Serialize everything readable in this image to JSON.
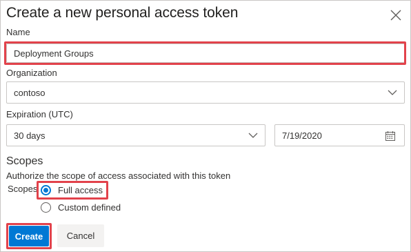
{
  "dialog": {
    "title": "Create a new personal access token"
  },
  "name": {
    "label": "Name",
    "value": "Deployment Groups"
  },
  "organization": {
    "label": "Organization",
    "value": "contoso"
  },
  "expiration": {
    "label": "Expiration (UTC)",
    "duration": "30 days",
    "date": "7/19/2020"
  },
  "scopes": {
    "title": "Scopes",
    "description": "Authorize the scope of access associated with this token",
    "label": "Scopes",
    "options": [
      {
        "label": "Full access",
        "selected": true
      },
      {
        "label": "Custom defined",
        "selected": false
      }
    ]
  },
  "actions": {
    "create": "Create",
    "cancel": "Cancel"
  },
  "colors": {
    "accent": "#0078d4",
    "highlight": "#e2424b"
  }
}
